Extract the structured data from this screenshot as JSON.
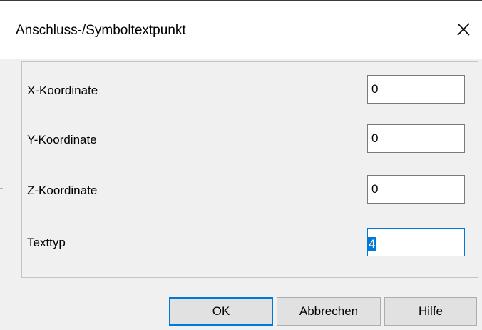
{
  "dialog": {
    "title": "Anschluss-/Symboltextpunkt",
    "close_icon": "close-icon"
  },
  "fields": [
    {
      "label": "X-Koordinate",
      "value": "0"
    },
    {
      "label": "Y-Koordinate",
      "value": "0"
    },
    {
      "label": "Z-Koordinate",
      "value": "0"
    },
    {
      "label": "Texttyp",
      "value": "4",
      "focused": true,
      "selected": true
    }
  ],
  "buttons": {
    "ok": "OK",
    "cancel": "Abbrechen",
    "help": "Hilfe"
  },
  "colors": {
    "accent": "#0078d7",
    "dialog_bg": "#f0f0f0",
    "button_bg": "#e1e1e1"
  }
}
